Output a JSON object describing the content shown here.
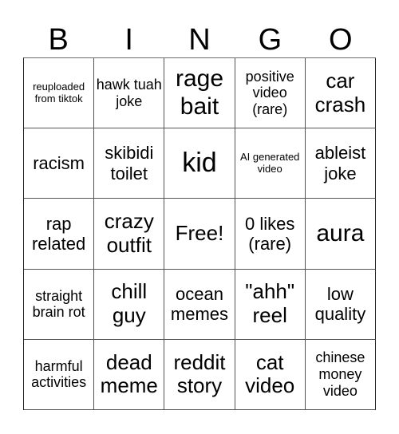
{
  "header": {
    "letters": [
      "B",
      "I",
      "N",
      "G",
      "O"
    ]
  },
  "board": {
    "cells": [
      {
        "text": "reuploaded from tiktok",
        "size": "s-xs"
      },
      {
        "text": "hawk tuah joke",
        "size": "s-sm"
      },
      {
        "text": "rage bait",
        "size": "s-xl"
      },
      {
        "text": "positive video (rare)",
        "size": "s-sm"
      },
      {
        "text": "car crash",
        "size": "s-lg"
      },
      {
        "text": "racism",
        "size": "s-md"
      },
      {
        "text": "skibidi toilet",
        "size": "s-md"
      },
      {
        "text": "kid",
        "size": "s-xxl"
      },
      {
        "text": "AI generated video",
        "size": "s-xs"
      },
      {
        "text": "ableist joke",
        "size": "s-md"
      },
      {
        "text": "rap related",
        "size": "s-md"
      },
      {
        "text": "crazy outfit",
        "size": "s-lg"
      },
      {
        "text": "Free!",
        "size": "s-lg"
      },
      {
        "text": "0 likes (rare)",
        "size": "s-md"
      },
      {
        "text": "aura",
        "size": "s-xl"
      },
      {
        "text": "straight brain rot",
        "size": "s-sm"
      },
      {
        "text": "chill guy",
        "size": "s-lg"
      },
      {
        "text": "ocean memes",
        "size": "s-md"
      },
      {
        "text": "\"ahh\" reel",
        "size": "s-lg"
      },
      {
        "text": "low quality",
        "size": "s-md"
      },
      {
        "text": "harmful activities",
        "size": "s-sm"
      },
      {
        "text": "dead meme",
        "size": "s-lg"
      },
      {
        "text": "reddit story",
        "size": "s-lg"
      },
      {
        "text": "cat video",
        "size": "s-lg"
      },
      {
        "text": "chinese money video",
        "size": "s-sm"
      }
    ]
  }
}
